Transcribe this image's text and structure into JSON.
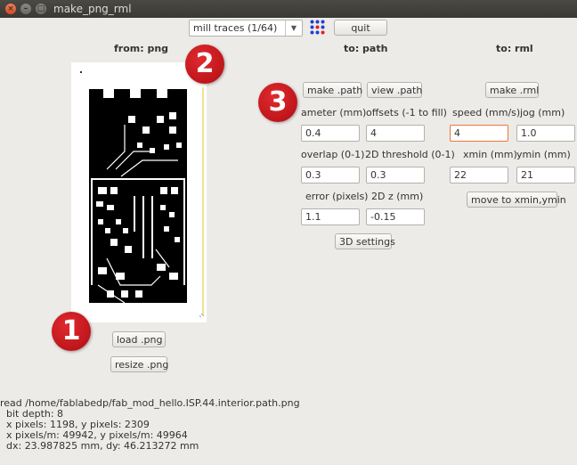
{
  "window": {
    "title": "make_png_rml"
  },
  "toolbar": {
    "mode_value": "mill traces (1/64)",
    "quit_label": "quit",
    "grid_icon": "blue-red-dots-icon"
  },
  "headers": {
    "from": "from: png",
    "to_path": "to: path",
    "to_rml": "to: rml"
  },
  "badges": {
    "one": "1",
    "two": "2",
    "three": "3"
  },
  "png": {
    "load_label": "load .png",
    "resize_label": "resize .png"
  },
  "path": {
    "make_label": "make .path",
    "view_label": "view .path",
    "diameter_label": "ameter (mm)",
    "diameter_value": "0.4",
    "offsets_label": "offsets (-1 to fill)",
    "offsets_value": "4",
    "overlap_label": "overlap (0-1)",
    "overlap_value": "0.3",
    "threshold_label": "2D threshold (0-1)",
    "threshold_value": "0.3",
    "error_label": "error (pixels)",
    "error_value": "1.1",
    "z_label": "2D z (mm)",
    "z_value": "-0.15",
    "settings3d_label": "3D settings"
  },
  "rml": {
    "make_label": "make .rml",
    "speed_label": "speed (mm/s)",
    "speed_value": "4",
    "jog_label": "jog (mm)",
    "jog_value": "1.0",
    "xmin_label": "xmin (mm)",
    "xmin_value": "22",
    "ymin_label": "ymin (mm)",
    "ymin_value": "21",
    "move_label": "move to xmin,ymin"
  },
  "info": {
    "read": "read /home/fablabedp/fab_mod_hello.ISP.44.interior.path.png",
    "bit_depth": "  bit depth: 8",
    "pixels": "  x pixels: 1198, y pixels: 2309",
    "pixels_per_m": "  x pixels/m: 49942, y pixels/m: 49964",
    "dims": "  dx: 23.987825 mm, dy: 46.213272 mm"
  }
}
